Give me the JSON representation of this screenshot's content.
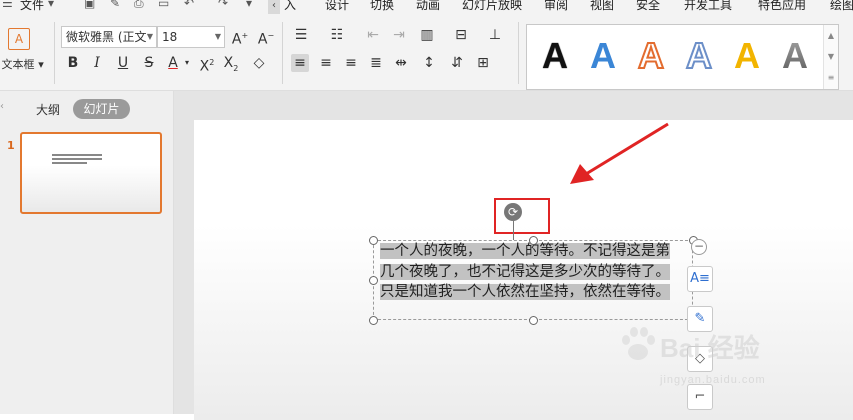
{
  "menubar": {
    "file_label": "文件",
    "tabs": [
      "入",
      "设计",
      "切换",
      "动画",
      "幻灯片放映",
      "审阅",
      "视图",
      "安全",
      "开发工具",
      "特色应用",
      "绘图"
    ],
    "scroll_left": "‹"
  },
  "ribbon": {
    "textbox_label": "文本框",
    "font_name": "微软雅黑 (正文",
    "font_size": "18",
    "art_text_letter": "A",
    "art_text_colors": [
      "#000000",
      "#3b86d6",
      "#e36c2f",
      "#6c8fc8",
      "#f2b400",
      "#777777"
    ]
  },
  "left_pane": {
    "tab_outline": "大纲",
    "tab_slides": "幻灯片",
    "slide_number": "1"
  },
  "textbox": {
    "text": "一个人的夜晚，一个人的等待。不记得这是第几个夜晚了，也不记得这是多少次的等待了。只是知道我一个人依然在坚持，依然在等待。"
  },
  "watermark": {
    "brand": "Bai 经验",
    "url": "jingyan.baidu.com"
  }
}
